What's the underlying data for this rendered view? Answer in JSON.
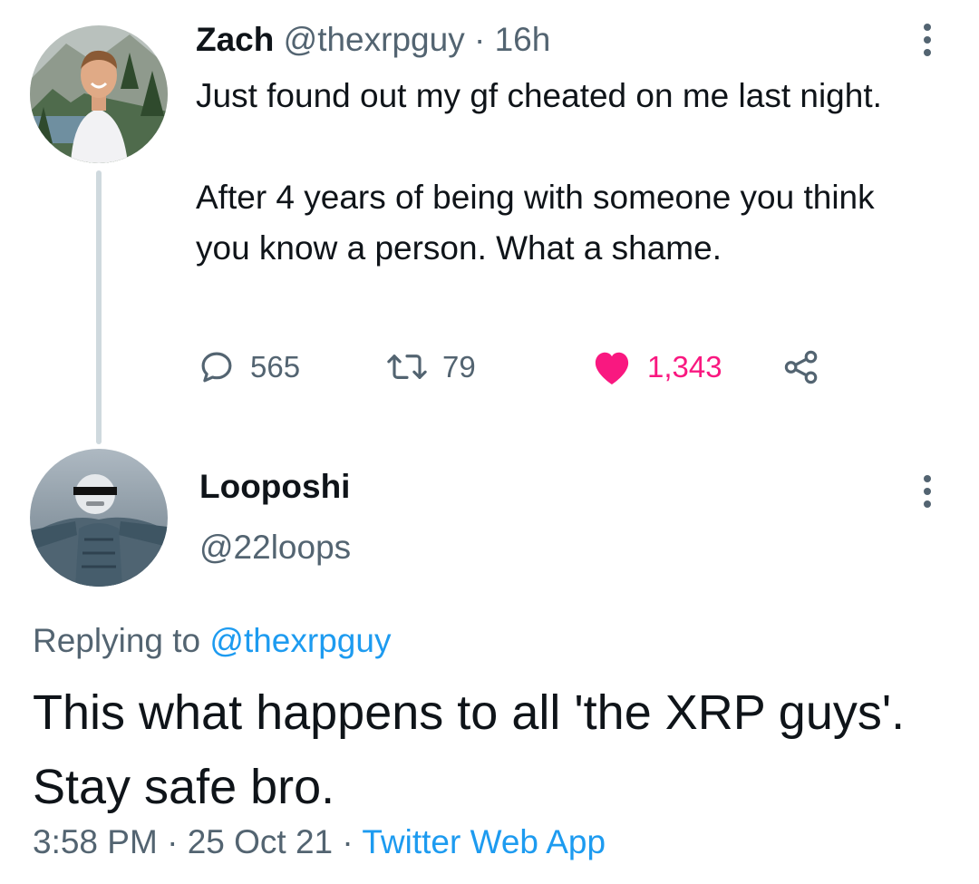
{
  "tweet": {
    "author_name": "Zach",
    "author_handle": "@thexrpguy",
    "separator": "·",
    "time_ago": "16h",
    "text_line_1": "Just found out my gf cheated on me last night.",
    "text_line_2": "After 4 years of being with someone you think you know a person. What a shame.",
    "reply_count": "565",
    "retweet_count": "79",
    "like_count": "1,343",
    "liked": true,
    "more_icon": "more-vertical-icon",
    "colors": {
      "like": "#f91880",
      "muted": "#536471",
      "link": "#1d9bf0"
    }
  },
  "reply": {
    "author_name": "Looposhi",
    "author_handle": "@22loops",
    "replying_to_label": "Replying to",
    "replying_to_handle": "@thexrpguy",
    "text": "This what happens to all 'the XRP guys'. Stay safe bro.",
    "time": "3:58 PM",
    "separator_1": "·",
    "date": "25 Oct 21",
    "separator_2": "·",
    "source": "Twitter Web App",
    "more_icon": "more-vertical-icon"
  }
}
